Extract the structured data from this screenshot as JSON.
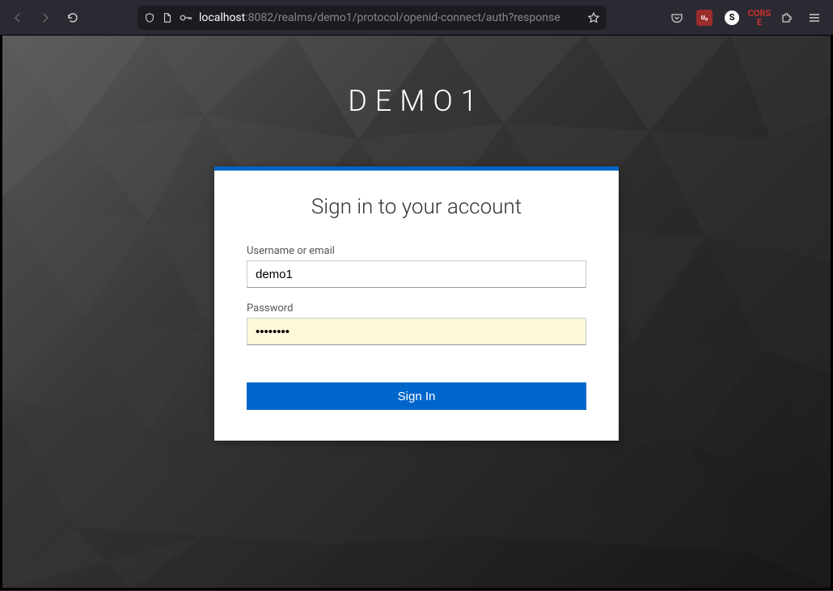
{
  "browser": {
    "url_host": "localhost",
    "url_path": ":8082/realms/demo1/protocol/openid-connect/auth?response"
  },
  "page": {
    "realm_title": "DEMO1",
    "card_title": "Sign in to your account",
    "username_label": "Username or email",
    "username_value": "demo1",
    "password_label": "Password",
    "password_value": "••••••••",
    "submit_label": "Sign In"
  }
}
